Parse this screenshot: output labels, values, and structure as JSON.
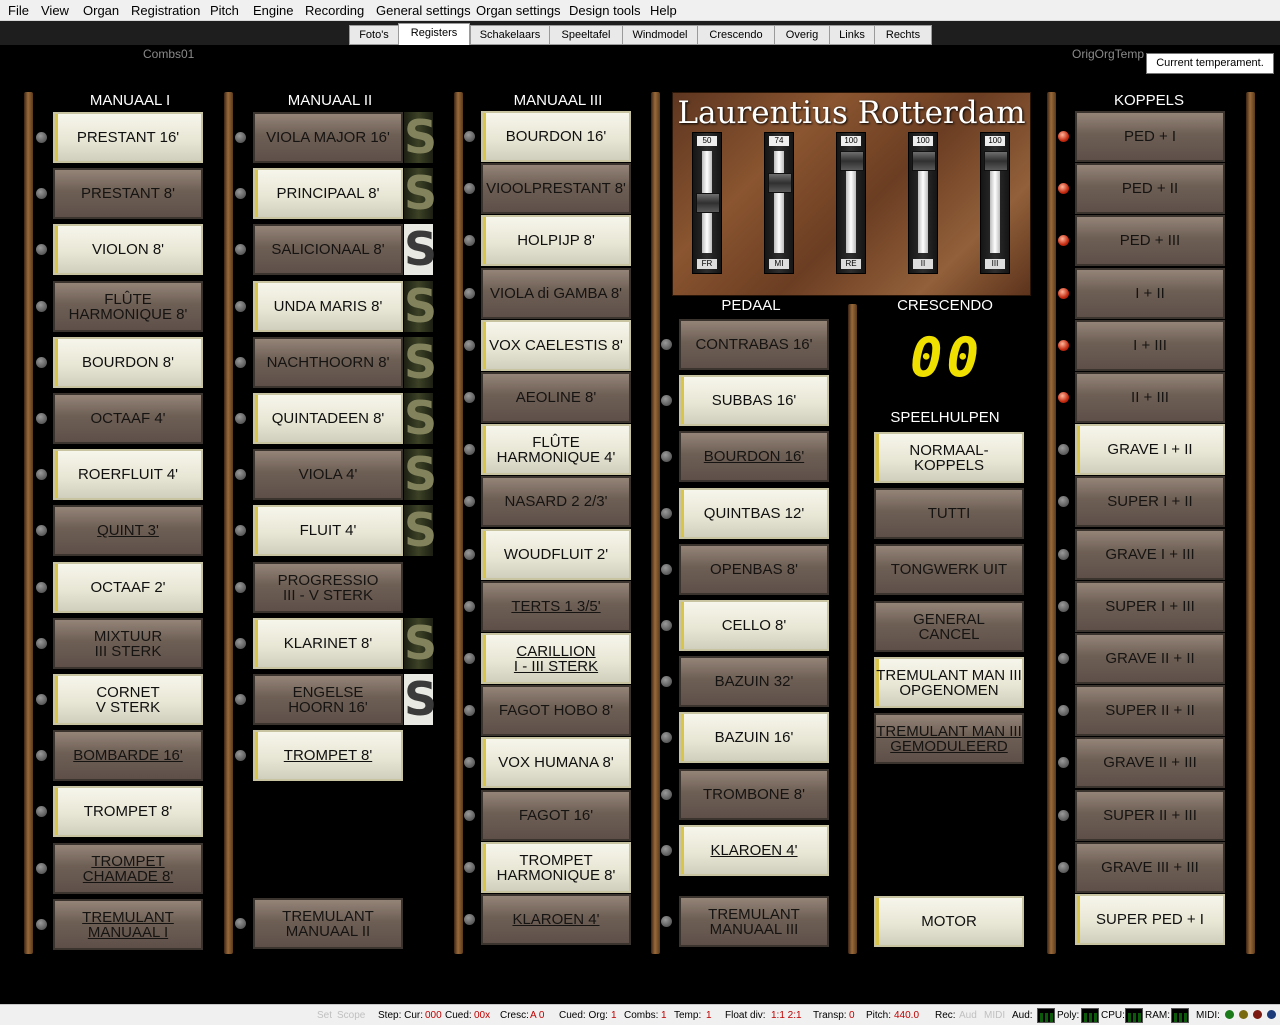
{
  "menu": [
    "File",
    "View",
    "Organ",
    "Registration",
    "Pitch",
    "Engine",
    "Recording",
    "General settings",
    "Organ settings",
    "Design tools",
    "Help"
  ],
  "tabs": {
    "left_label": "Combs01",
    "right_label": "OrigOrgTemp",
    "items": [
      "Foto's",
      "Registers",
      "Schakelaars",
      "Speeltafel",
      "Windmodel",
      "Crescendo",
      "Overig",
      "Links",
      "Rechts"
    ],
    "active": "Registers"
  },
  "tooltip": "Current temperament.",
  "headings": {
    "manuaal1": "MANUAAL I",
    "manuaal2": "MANUAAL II",
    "manuaal3": "MANUAAL III",
    "pedaal": "PEDAAL",
    "crescendo": "CRESCENDO",
    "speelhulpen": "SPEELHULPEN",
    "koppels": "KOPPELS"
  },
  "panel": {
    "title": "Laurentius Rotterdam",
    "sliders": [
      {
        "value": "50",
        "label": "FR",
        "level": 0.5
      },
      {
        "value": "74",
        "label": "MI",
        "level": 0.74
      },
      {
        "value": "100",
        "label": "RE",
        "level": 1.0
      },
      {
        "value": "100",
        "label": "II",
        "level": 1.0
      },
      {
        "value": "100",
        "label": "III",
        "level": 1.0
      }
    ]
  },
  "crescendo_display": "00",
  "manuaal1": [
    {
      "label": "PRESTANT 16'",
      "on": true,
      "u": false
    },
    {
      "label": "PRESTANT 8'",
      "on": false,
      "u": false
    },
    {
      "label": "VIOLON 8'",
      "on": true,
      "u": false
    },
    {
      "label": "FLÛTE\nHARMONIQUE 8'",
      "on": false,
      "u": false
    },
    {
      "label": "BOURDON 8'",
      "on": true,
      "u": false
    },
    {
      "label": "OCTAAF 4'",
      "on": false,
      "u": false
    },
    {
      "label": "ROERFLUIT 4'",
      "on": true,
      "u": false
    },
    {
      "label": "QUINT 3'",
      "on": false,
      "u": true
    },
    {
      "label": "OCTAAF 2'",
      "on": true,
      "u": false
    },
    {
      "label": "MIXTUUR\nIII STERK",
      "on": false,
      "u": false
    },
    {
      "label": "CORNET\nV STERK",
      "on": true,
      "u": false
    },
    {
      "label": "BOMBARDE 16'",
      "on": false,
      "u": true
    },
    {
      "label": "TROMPET 8'",
      "on": true,
      "u": false
    },
    {
      "label": "TROMPET\nCHAMADE 8'",
      "on": false,
      "u": true
    },
    {
      "label": "TREMULANT\nMANUAAL I",
      "on": false,
      "u": true
    }
  ],
  "manuaal2": [
    {
      "label": "VIOLA MAJOR 16'",
      "on": false,
      "u": false,
      "s": "dark"
    },
    {
      "label": "PRINCIPAAL 8'",
      "on": true,
      "u": false,
      "s": "dark"
    },
    {
      "label": "SALICIONAAL 8'",
      "on": false,
      "u": false,
      "s": "light"
    },
    {
      "label": "UNDA MARIS 8'",
      "on": true,
      "u": false,
      "s": "dark"
    },
    {
      "label": "NACHTHOORN 8'",
      "on": false,
      "u": false,
      "s": "dark"
    },
    {
      "label": "QUINTADEEN 8'",
      "on": true,
      "u": false,
      "s": "dark"
    },
    {
      "label": "VIOLA 4'",
      "on": false,
      "u": false,
      "s": "dark"
    },
    {
      "label": "FLUIT 4'",
      "on": true,
      "u": false,
      "s": "dark"
    },
    {
      "label": "PROGRESSIO\nIII - V STERK",
      "on": false,
      "u": false,
      "s": ""
    },
    {
      "label": "KLARINET 8'",
      "on": true,
      "u": false,
      "s": "dark"
    },
    {
      "label": "ENGELSE\nHOORN 16'",
      "on": false,
      "u": false,
      "s": "light"
    },
    {
      "label": "TROMPET 8'",
      "on": true,
      "u": true,
      "s": ""
    },
    {
      "label": "TREMULANT\nMANUAAL II",
      "on": false,
      "u": false,
      "s": ""
    }
  ],
  "manuaal3": [
    {
      "label": "BOURDON 16'",
      "on": true,
      "u": false
    },
    {
      "label": "VIOOLPRESTANT 8'",
      "on": false,
      "u": false
    },
    {
      "label": "HOLPIJP 8'",
      "on": true,
      "u": false
    },
    {
      "label": "VIOLA di GAMBA 8'",
      "on": false,
      "u": false
    },
    {
      "label": "VOX CAELESTIS 8'",
      "on": true,
      "u": false
    },
    {
      "label": "AEOLINE 8'",
      "on": false,
      "u": false
    },
    {
      "label": "FLÛTE\nHARMONIQUE 4'",
      "on": true,
      "u": false
    },
    {
      "label": "NASARD 2 2/3'",
      "on": false,
      "u": false
    },
    {
      "label": "WOUDFLUIT 2'",
      "on": true,
      "u": false
    },
    {
      "label": "TERTS 1 3/5'",
      "on": false,
      "u": true
    },
    {
      "label": "CARILLION\nI - III STERK",
      "on": true,
      "u": true
    },
    {
      "label": "FAGOT HOBO 8'",
      "on": false,
      "u": false
    },
    {
      "label": "VOX HUMANA 8'",
      "on": true,
      "u": false
    },
    {
      "label": "FAGOT 16'",
      "on": false,
      "u": false
    },
    {
      "label": "TROMPET\nHARMONIQUE 8'",
      "on": true,
      "u": false
    },
    {
      "label": "KLAROEN 4'",
      "on": false,
      "u": true
    }
  ],
  "pedaal": [
    {
      "label": "CONTRABAS 16'",
      "on": false,
      "u": false
    },
    {
      "label": "SUBBAS 16'",
      "on": true,
      "u": false
    },
    {
      "label": "BOURDON 16'",
      "on": false,
      "u": true
    },
    {
      "label": "QUINTBAS 12'",
      "on": true,
      "u": false
    },
    {
      "label": "OPENBAS 8'",
      "on": false,
      "u": false
    },
    {
      "label": "CELLO 8'",
      "on": true,
      "u": false
    },
    {
      "label": "BAZUIN 32'",
      "on": false,
      "u": false
    },
    {
      "label": "BAZUIN 16'",
      "on": true,
      "u": false
    },
    {
      "label": "TROMBONE 8'",
      "on": false,
      "u": false
    },
    {
      "label": "KLAROEN 4'",
      "on": true,
      "u": true
    },
    {
      "label": "TREMULANT\nMANUAAL III",
      "on": false,
      "u": false
    }
  ],
  "speelhulpen": [
    {
      "label": "NORMAAL-\nKOPPELS",
      "on": true,
      "u": false
    },
    {
      "label": "TUTTI",
      "on": false,
      "u": false
    },
    {
      "label": "TONGWERK UIT",
      "on": false,
      "u": false
    },
    {
      "label": "GENERAL\nCANCEL",
      "on": false,
      "u": false
    },
    {
      "label": "TREMULANT MAN III\nOPGENOMEN",
      "on": true,
      "u": false
    },
    {
      "label": "TREMULANT MAN III\nGEMODULEERD",
      "on": false,
      "u": true
    },
    {
      "label": "MOTOR",
      "on": true,
      "u": false
    }
  ],
  "koppels": [
    {
      "label": "PED + I",
      "on": false,
      "u": false,
      "lamp": "red"
    },
    {
      "label": "PED + II",
      "on": false,
      "u": false,
      "lamp": "red"
    },
    {
      "label": "PED + III",
      "on": false,
      "u": false,
      "lamp": "red"
    },
    {
      "label": "I + II",
      "on": false,
      "u": false,
      "lamp": "red"
    },
    {
      "label": "I + III",
      "on": false,
      "u": false,
      "lamp": "red"
    },
    {
      "label": "II + III",
      "on": false,
      "u": false,
      "lamp": "red"
    },
    {
      "label": "GRAVE I + II",
      "on": true,
      "u": false,
      "lamp": "grey"
    },
    {
      "label": "SUPER I + II",
      "on": false,
      "u": false,
      "lamp": "grey"
    },
    {
      "label": "GRAVE I + III",
      "on": false,
      "u": false,
      "lamp": "grey"
    },
    {
      "label": "SUPER I + III",
      "on": false,
      "u": false,
      "lamp": "grey"
    },
    {
      "label": "GRAVE II + II",
      "on": false,
      "u": false,
      "lamp": "grey"
    },
    {
      "label": "SUPER II + II",
      "on": false,
      "u": false,
      "lamp": "grey"
    },
    {
      "label": "GRAVE II + III",
      "on": false,
      "u": false,
      "lamp": "grey"
    },
    {
      "label": "SUPER II + III",
      "on": false,
      "u": false,
      "lamp": "grey"
    },
    {
      "label": "GRAVE III + III",
      "on": false,
      "u": false,
      "lamp": "grey"
    },
    {
      "label": "SUPER PED + I",
      "on": true,
      "u": false,
      "lamp": "none"
    }
  ],
  "status": {
    "set": "Set",
    "scope": "Scope",
    "step_label": "Step: Cur:",
    "step_cur": "000",
    "cued_label": "Cued:",
    "cued_val": "00x",
    "cresc_label": "Cresc:",
    "cresc_val": "A 0",
    "cued_org_label": "Cued: Org:",
    "cued_org_val": "1",
    "combs_label": "Combs:",
    "combs_val": "1",
    "temp_label": "Temp:",
    "temp_val": "1",
    "float_label": "Float div:",
    "float_val": "1:1 2:1",
    "transp_label": "Transp:",
    "transp_val": "0",
    "pitch_label": "Pitch:",
    "pitch_val": "440.0",
    "rec_label": "Rec:",
    "aud_dim": "Aud",
    "midi_dim": "MIDI",
    "aud_label": "Aud:",
    "poly_label": "Poly:",
    "cpu_label": "CPU:",
    "ram_label": "RAM:",
    "midi_label": "MIDI:"
  },
  "colors": {
    "stop_on": "#ecead8",
    "stop_off": "#7a6b60",
    "lamp_red": "#d0301a",
    "crescendo_led": "#f0e000",
    "status_red": "#c00000"
  }
}
